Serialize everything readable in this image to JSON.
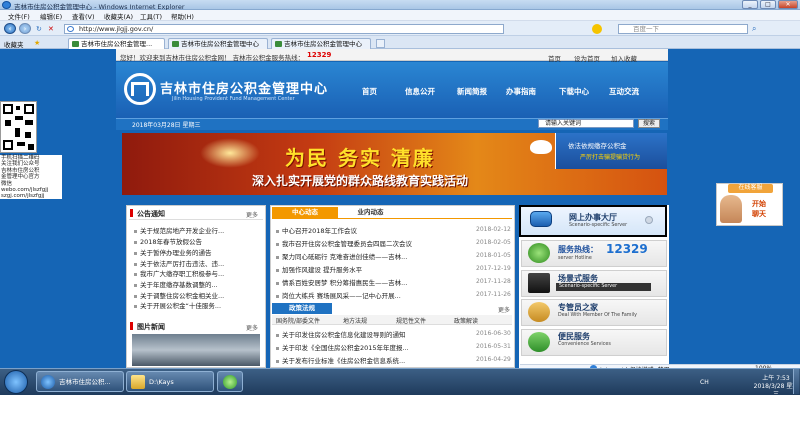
{
  "window": {
    "title": "吉林市住房公积金管理中心 - Windows Internet Explorer"
  },
  "menu": [
    "文件(F)",
    "编辑(E)",
    "查看(V)",
    "收藏夹(A)",
    "工具(T)",
    "帮助(H)"
  ],
  "address": {
    "url": "http://www.jlgjj.gov.cn/",
    "search_placeholder": "百度一下"
  },
  "favorites_label": "收藏夹",
  "tabs": [
    "吉林市住房公积金管理...",
    "吉林市住房公积金管理中心",
    "吉林市住房公积金管理中心"
  ],
  "site": {
    "welcome": "您好！欢迎来到吉林市住房公积金网！  吉林市公积金服务热线：",
    "hotline": "12329",
    "top_links": [
      "首页",
      "设为首页",
      "加入收藏"
    ],
    "logo_cn": "吉林市住房公积金管理中心",
    "logo_en": "Jilin Housing Provident Fund Management Center",
    "nav": [
      "首页",
      "信息公开",
      "新闻简报",
      "办事指南",
      "下载中心",
      "互动交流"
    ],
    "date": "2018年03月28日 星期三",
    "search_value": "请输入关键词",
    "search_button": "搜索",
    "banner_title": "为民 务实 清廉",
    "banner_sub": "深入扎实开展党的群众路线教育实践活动",
    "banner_right_1": "依法依规缴存公积金",
    "banner_right_2": "严厉打击骗提骗贷行为",
    "qr_note": [
      "手机扫描二维码",
      "关注我们公众号",
      "吉林市住房公积",
      "金管理中心官方",
      "微信",
      "webo.com/jlszfgjj",
      "szgj.com/jlszfgjj"
    ],
    "cs_head": "在线客服",
    "cs_text": [
      "开始",
      "聊天"
    ],
    "notice": {
      "title": "公告通知",
      "more": "更多",
      "items": [
        "关于规范房地产开发企业行...",
        "2018年春节放假公告",
        "关于暂停办理业务的通告",
        "关于依法严厉打击违法、违...",
        "我市广大缴存职工积极参与...",
        "关于年度缴存基数调整的...",
        "关于调整住房公积金相关业...",
        "关于开展公积金“十佳服务..."
      ]
    },
    "photo_news": {
      "title": "图片新闻",
      "more": "更多"
    },
    "news": {
      "tab1": "中心动态",
      "tab2": "业内动态",
      "items": [
        {
          "t": "中心召开2018年工作会议",
          "d": "2018-02-12"
        },
        {
          "t": "我市召开住房公积金管理委员会四届二次会议",
          "d": "2018-02-05"
        },
        {
          "t": "聚力同心砥砺行 克难奋进创佳绩——吉林...",
          "d": "2018-01-05"
        },
        {
          "t": "加强作风建设 提升服务水平",
          "d": "2017-12-19"
        },
        {
          "t": "情系百姓安居梦 积分筹措惠民生——吉林...",
          "d": "2017-11-28"
        },
        {
          "t": "岗位大练兵 赛场展风采——记中心开展...",
          "d": "2017-11-26"
        }
      ]
    },
    "policy": {
      "title": "政策法规",
      "more": "更多",
      "tabs": [
        "国务院/部委文件",
        "地方法规",
        "规范性文件",
        "政策解读"
      ],
      "items": [
        {
          "t": "关于印发住房公积金信息化建设导则的通知",
          "d": "2016-06-30"
        },
        {
          "t": "关于印发《全国住房公积金2015年年度报...",
          "d": "2016-05-31"
        },
        {
          "t": "关于发布行业标准《住房公积金信息系统...",
          "d": "2016-04-29"
        }
      ]
    },
    "services": [
      {
        "title": "网上办事大厅",
        "sub": "Scenario-specific Server"
      },
      {
        "title": "服务热线：",
        "hot": "12329",
        "sub": "server Hotline"
      },
      {
        "title": "场景式服务",
        "sub": "Scenario-specific Server"
      },
      {
        "title": "专管员之家",
        "sub": "Deal With Member Of The Family"
      },
      {
        "title": "便民服务",
        "sub": "Convenience Services"
      }
    ]
  },
  "status": {
    "zone": "Internet | 保护模式: 禁用",
    "zoom": "100%"
  },
  "taskbar": {
    "items": [
      "吉林市住房公积...",
      "D:\\Kays",
      "计"
    ],
    "lang": "CH",
    "time": "上午 7:53",
    "date": "2018/3/28 星期三"
  },
  "colors": {
    "page_blue": "#1565b5",
    "accent_orange": "#f39800",
    "hotline_red": "#d00000"
  }
}
